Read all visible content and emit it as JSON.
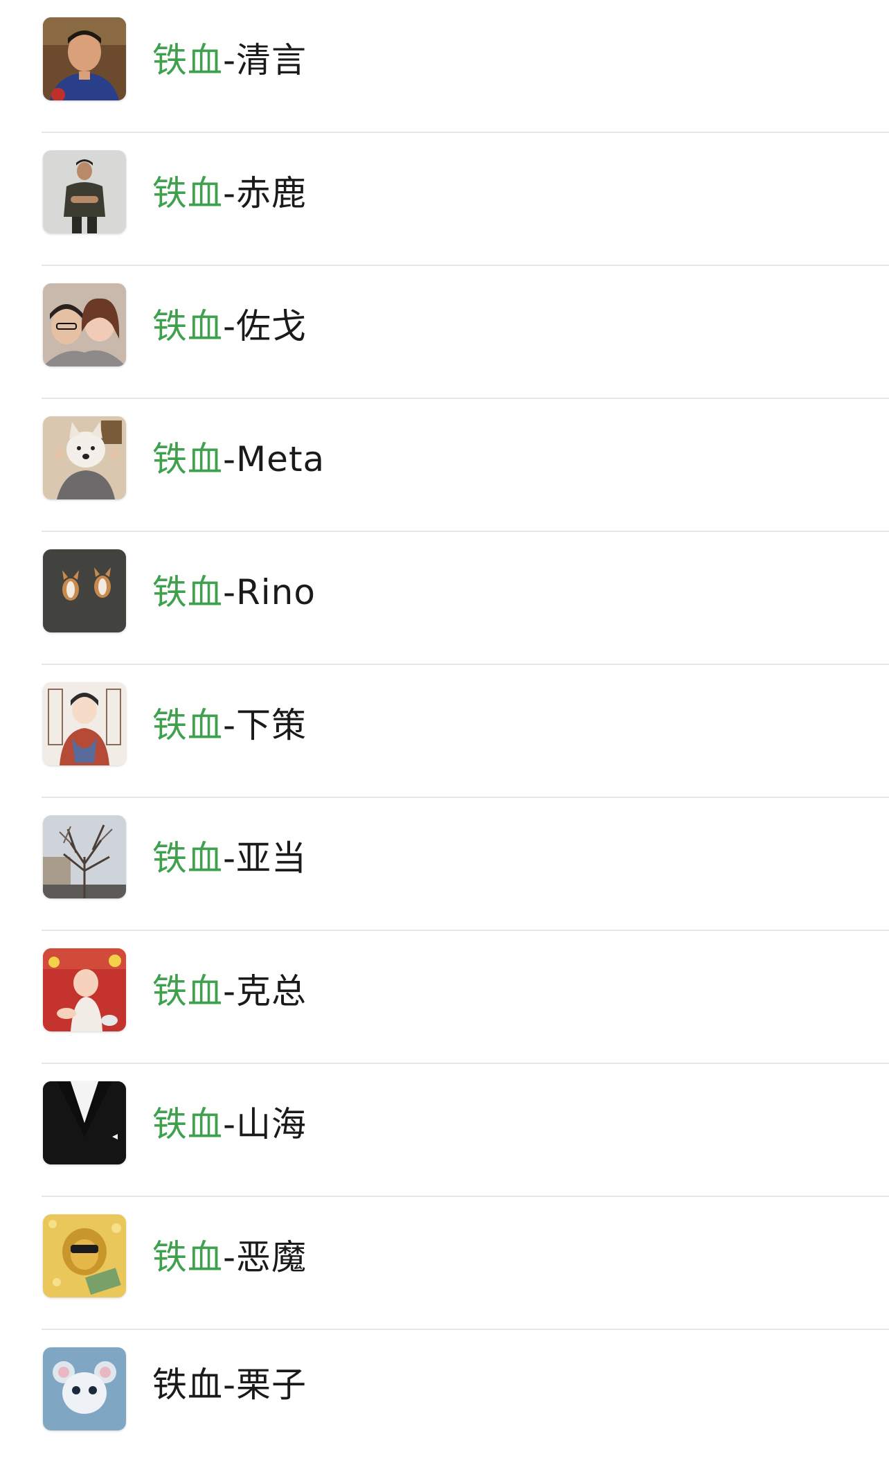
{
  "search_highlight_color": "#3fa14e",
  "contacts": [
    {
      "prefix": "铁血",
      "suffix": "-清言",
      "avatar": "boy-portrait-avatar"
    },
    {
      "prefix": "铁血",
      "suffix": "-赤鹿",
      "avatar": "man-standing-avatar"
    },
    {
      "prefix": "铁血",
      "suffix": "-佐戈",
      "avatar": "couple-selfie-avatar"
    },
    {
      "prefix": "铁血",
      "suffix": "-Meta",
      "avatar": "dog-face-avatar"
    },
    {
      "prefix": "铁血",
      "suffix": "-Rino",
      "avatar": "corgi-dogs-avatar"
    },
    {
      "prefix": "铁血",
      "suffix": "-下策",
      "avatar": "cartoon-boy-avatar"
    },
    {
      "prefix": "铁血",
      "suffix": "-亚当",
      "avatar": "tree-street-avatar"
    },
    {
      "prefix": "铁血",
      "suffix": "-克总",
      "avatar": "baby-avatar"
    },
    {
      "prefix": "铁血",
      "suffix": "-山海",
      "avatar": "tuxedo-avatar"
    },
    {
      "prefix": "铁血",
      "suffix": "-恶魔",
      "avatar": "gold-lion-avatar"
    },
    {
      "prefix": "铁血",
      "suffix": "-栗子",
      "avatar": "mouse-3d-avatar"
    }
  ]
}
